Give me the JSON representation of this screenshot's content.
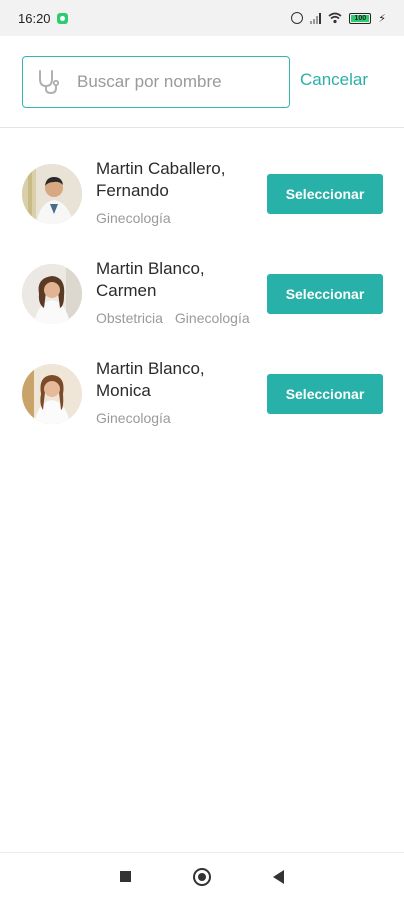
{
  "status_bar": {
    "time": "16:20",
    "battery": "100",
    "icons": [
      "app-notification-icon",
      "alarm-icon",
      "signal-icon",
      "wifi-icon",
      "battery-icon",
      "charging-icon"
    ]
  },
  "search": {
    "placeholder": "Buscar por nombre",
    "value": "",
    "cancel_label": "Cancelar",
    "icon": "stethoscope-icon"
  },
  "colors": {
    "accent": "#2bb0a7",
    "button": "#27b1a8",
    "muted_text": "#9a9a9a"
  },
  "doctors": [
    {
      "name_line1": "Martin Caballero,",
      "name_line2": "Fernando",
      "specialties": [
        "Ginecología"
      ],
      "button_label": "Seleccionar"
    },
    {
      "name_line1": "Martin  Blanco,",
      "name_line2": "Carmen",
      "specialties": [
        "Obstetricia",
        "Ginecología"
      ],
      "button_label": "Seleccionar"
    },
    {
      "name_line1": "Martin  Blanco,",
      "name_line2": "Monica",
      "specialties": [
        "Ginecología"
      ],
      "button_label": "Seleccionar"
    }
  ],
  "nav_bar": {
    "icons": [
      "recents-square-icon",
      "home-circle-icon",
      "back-triangle-icon"
    ]
  }
}
